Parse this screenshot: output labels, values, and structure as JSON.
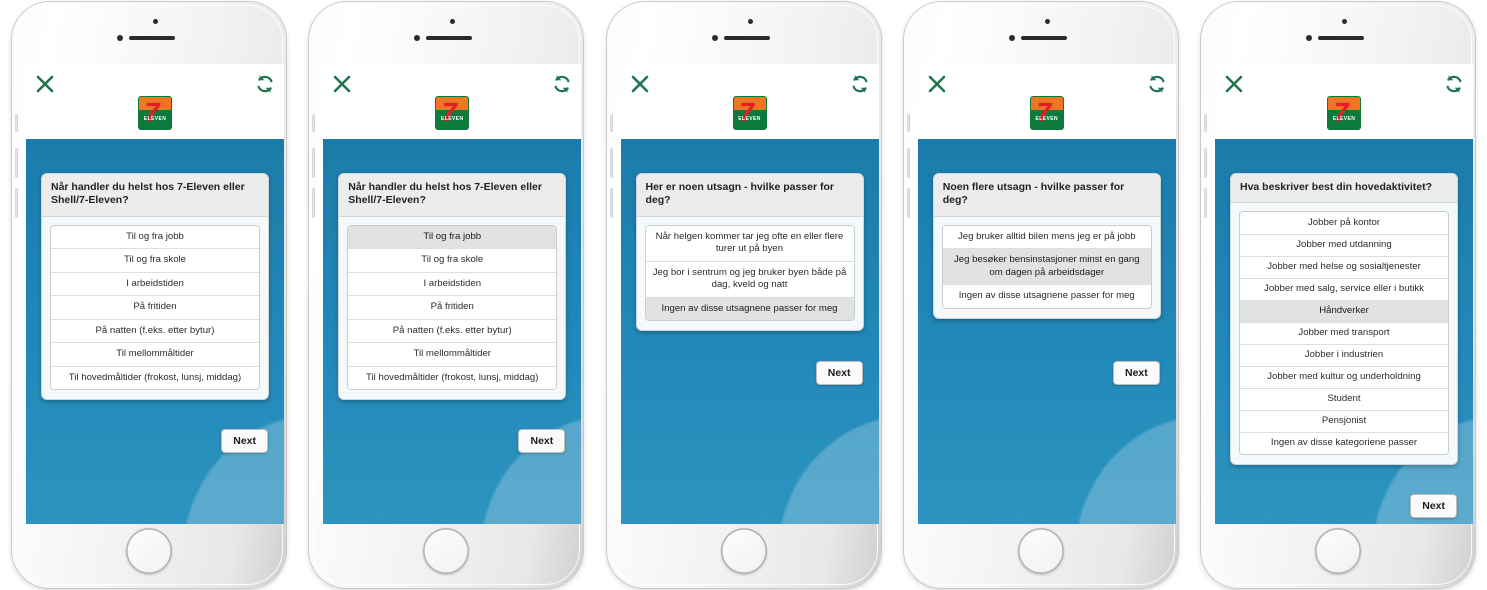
{
  "app": {
    "brand": {
      "name": "7-Eleven",
      "seven": "7",
      "eleven": "ELEVEN",
      "colors": {
        "orange": "#ef7622",
        "green": "#0d7a3d",
        "red": "#df2027"
      }
    },
    "icons": {
      "close": "close-icon",
      "refresh": "refresh-icon"
    },
    "theme": {
      "screen_blue": "#1d7fae",
      "accent_green": "#20764f",
      "card_header_gray": "#ececec",
      "selected_gray": "#e2e2e2"
    },
    "next_label": "Next"
  },
  "screens": [
    {
      "id": "screen-1",
      "question": "Når handler du helst hos 7-Eleven eller Shell/7-Eleven?",
      "options": [
        {
          "label": "Til og fra jobb",
          "selected": false
        },
        {
          "label": "Til og fra skole",
          "selected": false
        },
        {
          "label": "I arbeidstiden",
          "selected": false
        },
        {
          "label": "På fritiden",
          "selected": false
        },
        {
          "label": "På natten (f.eks. etter bytur)",
          "selected": false
        },
        {
          "label": "Til mellommåltider",
          "selected": false
        },
        {
          "label": "Til hovedmåltider (frokost, lunsj, middag)",
          "selected": false
        }
      ],
      "next_label": "Next"
    },
    {
      "id": "screen-2",
      "question": "Når handler du helst hos 7-Eleven eller Shell/7-Eleven?",
      "options": [
        {
          "label": "Til og fra jobb",
          "selected": true
        },
        {
          "label": "Til og fra skole",
          "selected": false
        },
        {
          "label": "I arbeidstiden",
          "selected": false
        },
        {
          "label": "På fritiden",
          "selected": false
        },
        {
          "label": "På natten (f.eks. etter bytur)",
          "selected": false
        },
        {
          "label": "Til mellommåltider",
          "selected": false
        },
        {
          "label": "Til hovedmåltider (frokost, lunsj, middag)",
          "selected": false
        }
      ],
      "next_label": "Next"
    },
    {
      "id": "screen-3",
      "question": "Her er noen utsagn - hvilke passer for deg?",
      "options": [
        {
          "label": "Når helgen kommer tar jeg ofte en eller flere turer ut på byen",
          "selected": false
        },
        {
          "label": "Jeg bor i sentrum og jeg bruker byen både på dag, kveld og natt",
          "selected": false
        },
        {
          "label": "Ingen av disse utsagnene passer for meg",
          "selected": true
        }
      ],
      "next_label": "Next"
    },
    {
      "id": "screen-4",
      "question": "Noen flere utsagn - hvilke passer for deg?",
      "options": [
        {
          "label": "Jeg bruker alltid bilen mens jeg er på jobb",
          "selected": false
        },
        {
          "label": "Jeg besøker bensinstasjoner minst en gang om dagen på arbeidsdager",
          "selected": true
        },
        {
          "label": "Ingen av disse utsagnene passer for meg",
          "selected": false
        }
      ],
      "next_label": "Next"
    },
    {
      "id": "screen-5",
      "question": "Hva beskriver best din hovedaktivitet?",
      "options": [
        {
          "label": "Jobber på kontor",
          "selected": false
        },
        {
          "label": "Jobber med utdanning",
          "selected": false
        },
        {
          "label": "Jobber med helse og sosialtjenester",
          "selected": false
        },
        {
          "label": "Jobber med salg, service eller i butikk",
          "selected": false
        },
        {
          "label": "Håndverker",
          "selected": true
        },
        {
          "label": "Jobber med transport",
          "selected": false
        },
        {
          "label": "Jobber i industrien",
          "selected": false
        },
        {
          "label": "Jobber med kultur og underholdning",
          "selected": false
        },
        {
          "label": "Student",
          "selected": false
        },
        {
          "label": "Pensjonist",
          "selected": false
        },
        {
          "label": "Ingen av disse kategoriene passer",
          "selected": false
        }
      ],
      "next_label": "Next"
    }
  ]
}
